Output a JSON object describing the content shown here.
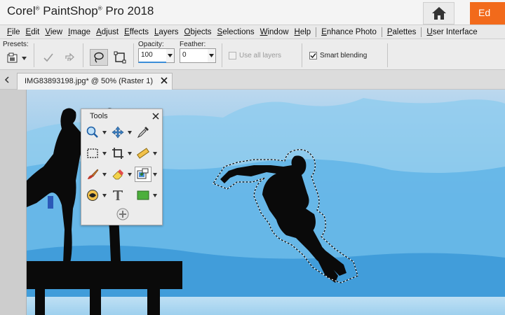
{
  "window": {
    "title_brand": "Corel",
    "title_trade": "®",
    "title_product": "PaintShop",
    "title_trade2": "®",
    "title_rest": "Pro 2018",
    "edit_tab_label": "Ed"
  },
  "menu": {
    "items": [
      "File",
      "Edit",
      "View",
      "Image",
      "Adjust",
      "Effects",
      "Layers",
      "Objects",
      "Selections",
      "Window",
      "Help"
    ],
    "extra": [
      "Enhance Photo",
      "Palettes",
      "User Interface"
    ]
  },
  "options": {
    "presets_label": "Presets:",
    "opacity_label": "Opacity:",
    "opacity_value": "100",
    "feather_label": "Feather:",
    "feather_value": "0",
    "use_all_layers_label": "Use all layers",
    "use_all_layers_checked": false,
    "smart_blending_label": "Smart blending",
    "smart_blending_checked": true
  },
  "document_tab": {
    "label": "IMG83893198.jpg* @  50% (Raster 1)"
  },
  "tools_palette": {
    "title": "Tools",
    "tools": [
      [
        "zoom-icon",
        "pan-icon",
        "eyedropper-icon"
      ],
      [
        "selection-rect-icon",
        "crop-icon",
        "straighten-icon"
      ],
      [
        "paintbrush-icon",
        "eraser-icon",
        "object-extractor-icon"
      ],
      [
        "smart-carver-icon",
        "text-icon",
        "shape-rect-icon"
      ]
    ]
  },
  "colors": {
    "accent_orange": "#f26a1b",
    "sky_top": "#bcd8ee",
    "sky_bottom": "#45a3e0",
    "shape_green": "#4caf3c"
  }
}
